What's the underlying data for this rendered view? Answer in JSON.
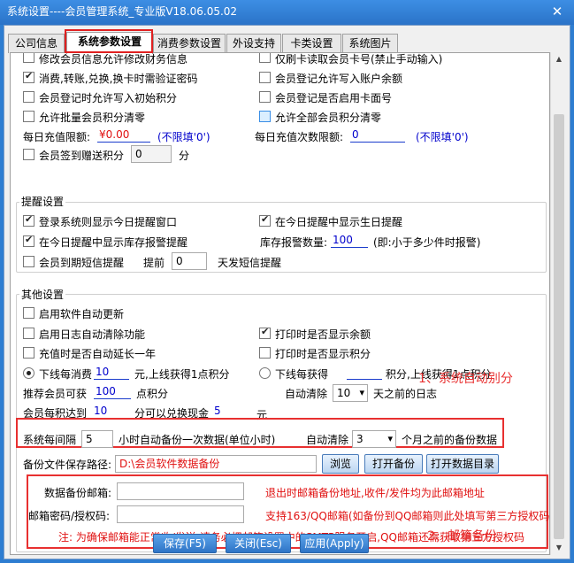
{
  "window": {
    "title": "系统设置----会员管理系统_专业版V18.06.05.02",
    "close": "✕"
  },
  "tabs": [
    {
      "label": "公司信息"
    },
    {
      "label": "系统参数设置"
    },
    {
      "label": "消费参数设置"
    },
    {
      "label": "外设支持"
    },
    {
      "label": "卡类设置"
    },
    {
      "label": "系统图片"
    }
  ],
  "top": {
    "c1": "修改会员信息允许修改财务信息",
    "c2": "仅刷卡读取会员卡号(禁止手动输入)",
    "c3": "消费,转账,兑换,换卡时需验证密码",
    "c4": "会员登记允许写入账户余额",
    "c5": "会员登记时允许写入初始积分",
    "c6": "会员登记是否启用卡面号",
    "c7": "允许批量会员积分清零",
    "c8": "允许全部会员积分清零",
    "daily_limit_label": "每日充值限额:",
    "daily_limit_value": "¥0.00",
    "unlimited_hint": "(不限填'0')",
    "daily_count_label": "每日充值次数限额:",
    "daily_count_value": "0",
    "unlimited_hint2": "(不限填'0')",
    "signin_label": "会员签到赠送积分",
    "signin_value": "0",
    "signin_unit": "分"
  },
  "reminder": {
    "title": "提醒设置",
    "r1": "登录系统则显示今日提醒窗口",
    "r2": "在今日提醒中显示生日提醒",
    "r3": "在今日提醒中显示库存报警提醒",
    "stock_label": "库存报警数量:",
    "stock_value": "100",
    "stock_hint": "(即:小于多少件时报警)",
    "sms_label": "会员到期短信提醒",
    "sms_before": "提前",
    "sms_days": "0",
    "sms_after": "天发短信提醒"
  },
  "other": {
    "title": "其他设置",
    "o1": "启用软件自动更新",
    "o2": "启用日志自动清除功能",
    "o3": "打印时是否显示余额",
    "o4": "充值时是否自动延长一年",
    "o5": "打印时是否显示积分",
    "rad1_pre": "下线每消费",
    "rad1_value": "10",
    "rad1_post": "元,上线获得1点积分",
    "rad2_pre": "下线每获得",
    "rad2_post": "积分,上线获得1点积分",
    "recommend_label": "推荐会员可获",
    "recommend_value": "100",
    "recommend_unit": "点积分",
    "autoclear_label": "自动清除",
    "autoclear_value": "10",
    "autoclear_post": "天之前的日志",
    "exchange_pre": "会员每积达到",
    "exchange_value": "10",
    "exchange_mid": "分可以兑换现金",
    "exchange_value2": "5",
    "exchange_unit": "元",
    "backup_pre": "系统每间隔",
    "backup_hours": "5",
    "backup_post": "小时自动备份一次数据(单位小时)",
    "backup_clear_label": "自动清除",
    "backup_clear_value": "3",
    "backup_clear_post": "个月之前的备份数据",
    "path_label": "备份文件保存路径:",
    "path_value": "D:\\会员软件数据备份",
    "browse": "浏览",
    "open_backup": "打开备份",
    "open_data_dir": "打开数据目录"
  },
  "email": {
    "email_label": "数据备份邮箱:",
    "email_value": "",
    "email_hint": "退出时邮箱备份地址,收件/发件均为此邮箱地址",
    "pwd_label": "邮箱密码/授权码:",
    "pwd_value": "",
    "pwd_hint": "支持163/QQ邮箱(如备份到QQ邮箱则此处填写第三方授权码)",
    "note": "注: 为确保邮箱能正常收/发送,请务必把邮箱设置中的SMTP服务开启,QQ邮箱还需获取第三方授权码"
  },
  "annotations": {
    "a1": "1、系统自动别分",
    "a2": "2、邮箱备份"
  },
  "buttons": {
    "save": "保存(F5)",
    "close": "关闭(Esc)",
    "apply": "应用(Apply)"
  }
}
